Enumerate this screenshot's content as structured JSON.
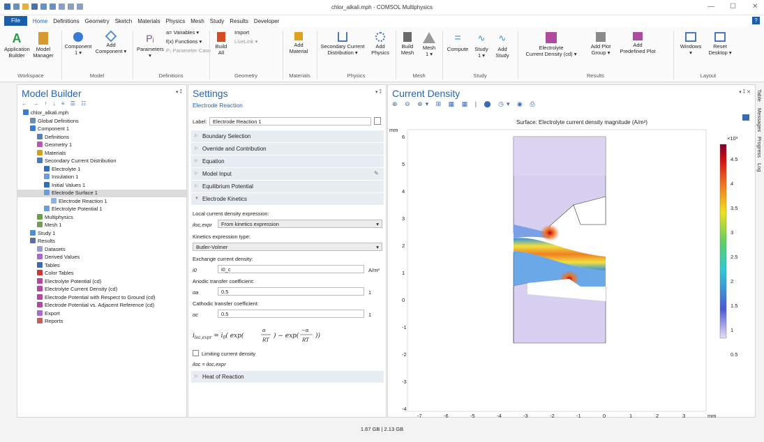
{
  "window": {
    "title": "chlor_alkali.mph - COMSOL Multiphysics",
    "minimize": "—",
    "maximize": "☐",
    "close": "✕"
  },
  "menu": {
    "file": "File",
    "items": [
      "Home",
      "Definitions",
      "Geometry",
      "Sketch",
      "Materials",
      "Physics",
      "Mesh",
      "Study",
      "Results",
      "Developer"
    ],
    "help": "?"
  },
  "ribbon": {
    "app_builder": "Application\nBuilder",
    "model_manager": "Model\nManager",
    "component": "Component\n1 ▾",
    "add_component": "Add\nComponent ▾",
    "parameters": "Parameters\n▾",
    "variables": "a= Variables ▾",
    "functions": "f(x) Functions ▾",
    "parameter_case": "P₁ Parameter Case",
    "build_all": "Build\nAll",
    "import": "Import",
    "livelink": "LiveLink ▾",
    "add_material": "Add\nMaterial",
    "secondary_current": "Secondary Current\nDistribution ▾",
    "add_physics": "Add\nPhysics",
    "build_mesh": "Build\nMesh",
    "mesh1": "Mesh\n1 ▾",
    "compute": "Compute",
    "study1": "Study\n1 ▾",
    "add_study": "Add\nStudy",
    "electrolyte_cd": "Electrolyte\nCurrent Density (cd) ▾",
    "add_plot_group": "Add Plot\nGroup ▾",
    "add_predefined_plot": "Add\nPredefined Plot",
    "windows": "Windows\n▾",
    "reset_desktop": "Reset\nDesktop ▾",
    "groups": [
      "Workspace",
      "Model",
      "Definitions",
      "Geometry",
      "Materials",
      "Physics",
      "Mesh",
      "Study",
      "Results",
      "Layout"
    ]
  },
  "model_builder": {
    "title": "Model Builder",
    "items": [
      {
        "label": "chlor_alkali.mph",
        "lvl": 0,
        "color": "#3a7bd5"
      },
      {
        "label": "Global Definitions",
        "lvl": 1,
        "color": "#6a8fb5"
      },
      {
        "label": "Component 1",
        "lvl": 1,
        "color": "#3a7bd5"
      },
      {
        "label": "Definitions",
        "lvl": 2,
        "color": "#5a7fb0"
      },
      {
        "label": "Geometry 1",
        "lvl": 2,
        "color": "#b45ab4"
      },
      {
        "label": "Materials",
        "lvl": 2,
        "color": "#d4a020"
      },
      {
        "label": "Secondary Current Distribution",
        "lvl": 2,
        "color": "#4a78b8"
      },
      {
        "label": "Electrolyte 1",
        "lvl": 3,
        "color": "#2f6fb8"
      },
      {
        "label": "Insulation 1",
        "lvl": 3,
        "color": "#6c9ed6"
      },
      {
        "label": "Initial Values 1",
        "lvl": 3,
        "color": "#2f6fb8"
      },
      {
        "label": "Electrode Surface 1",
        "lvl": 3,
        "color": "#6c9ed6"
      },
      {
        "label": "Electrode Reaction 1",
        "lvl": 4,
        "color": "#8fb3df"
      },
      {
        "label": "Electrolyte Potential 1",
        "lvl": 3,
        "color": "#6c9ed6"
      },
      {
        "label": "Multiphysics",
        "lvl": 2,
        "color": "#6aa04a"
      },
      {
        "label": "Mesh 1",
        "lvl": 2,
        "color": "#7a9a5a"
      },
      {
        "label": "Study 1",
        "lvl": 1,
        "color": "#4a8fd0"
      },
      {
        "label": "Results",
        "lvl": 1,
        "color": "#5a6fa0"
      },
      {
        "label": "Datasets",
        "lvl": 2,
        "color": "#9a9ad0"
      },
      {
        "label": "Derived Values",
        "lvl": 2,
        "color": "#a86ad0"
      },
      {
        "label": "Tables",
        "lvl": 2,
        "color": "#3a6ab0"
      },
      {
        "label": "Color Tables",
        "lvl": 2,
        "color": "#c83a3a"
      },
      {
        "label": "Electrolyte Potential (cd)",
        "lvl": 2,
        "color": "#b04aa0"
      },
      {
        "label": "Electrolyte Current Density (cd)",
        "lvl": 2,
        "color": "#b04aa0"
      },
      {
        "label": "Electrode Potential with Respect to Ground (cd)",
        "lvl": 2,
        "color": "#b04aa0"
      },
      {
        "label": "Electrode Potential vs. Adjacent Reference (cd)",
        "lvl": 2,
        "color": "#b04aa0"
      },
      {
        "label": "Export",
        "lvl": 2,
        "color": "#a86ad0"
      },
      {
        "label": "Reports",
        "lvl": 2,
        "color": "#c06060"
      }
    ]
  },
  "settings": {
    "title": "Settings",
    "subtitle": "Electrode Reaction",
    "label_caption": "Label:",
    "label_value": "Electrode Reaction 1",
    "sections": [
      "Boundary Selection",
      "Override and Contribution",
      "Equation",
      "Model Input",
      "Equilibrium Potential",
      "Electrode Kinetics"
    ],
    "local_cd_caption": "Local current density expression:",
    "iloc_sym": "iloc,expr",
    "iloc_value": "From kinetics expression",
    "kinetics_caption": "Kinetics expression type:",
    "kinetics_value": "Butler-Volmer",
    "exchange_caption": "Exchange current density:",
    "i0_sym": "i0",
    "i0_value": "i0_c",
    "i0_unit": "A/m²",
    "anodic_caption": "Anodic transfer coefficient:",
    "aa_sym": "αa",
    "aa_value": "0.5",
    "aa_unit": "1",
    "cathodic_caption": "Cathodic transfer coefficient:",
    "ac_sym": "αc",
    "ac_value": "0.5",
    "ac_unit": "1",
    "limiting": "Limiting current density",
    "iloc_eq": "iloc = iloc,expr",
    "heat": "Heat of Reaction"
  },
  "graphics": {
    "title": "Current Density",
    "plot_title": "Surface: Electrolyte current density magnitude (A/m²)",
    "axis_unit": "mm",
    "colorbar_exp": "×10³",
    "colorbar_ticks": [
      "4.5",
      "4",
      "3.5",
      "3",
      "2.5",
      "2",
      "1.5",
      "1",
      "0.5"
    ],
    "x_ticks": [
      "-7",
      "-6",
      "-5",
      "-4",
      "-3",
      "-2",
      "-1",
      "0",
      "1",
      "2",
      "3"
    ],
    "y_ticks": [
      "6",
      "5",
      "4",
      "3",
      "2",
      "1",
      "0",
      "-1",
      "-2",
      "-3",
      "-4"
    ]
  },
  "side_tabs": [
    "Table",
    "Messages",
    "Progress",
    "Log"
  ],
  "status": {
    "memory": "1.67 GB | 2.13 GB"
  }
}
